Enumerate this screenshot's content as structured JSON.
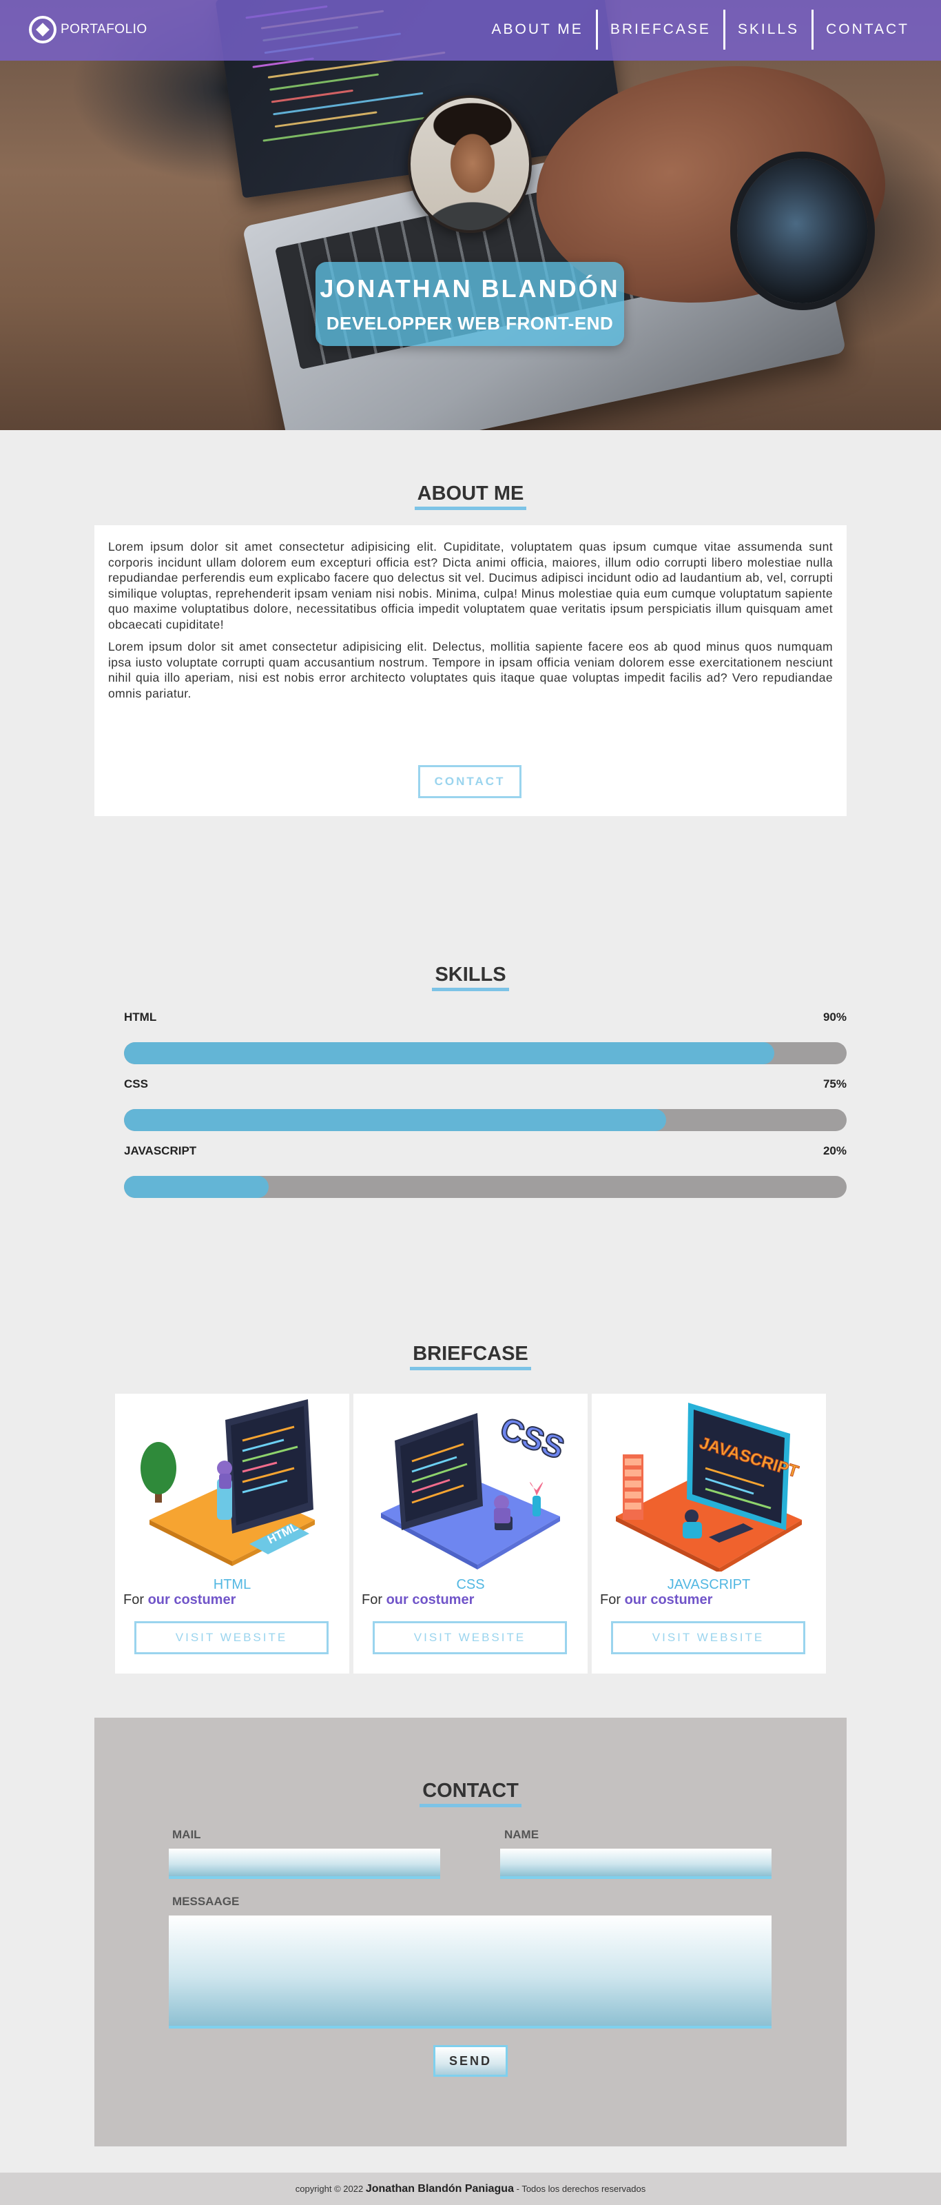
{
  "nav": {
    "logo_text": "PORTAFOLIO",
    "items": [
      {
        "label": "ABOUT ME"
      },
      {
        "label": "BRIEFCASE"
      },
      {
        "label": "SKILLS"
      },
      {
        "label": "CONTACT"
      }
    ]
  },
  "hero": {
    "name": "JONATHAN BLANDÓN",
    "role": "DEVELOPPER WEB FRONT-END"
  },
  "about": {
    "title": "ABOUT ME",
    "paragraph_1": "Lorem ipsum dolor sit amet consectetur adipisicing elit. Cupiditate, voluptatem quas ipsum cumque vitae assumenda sunt corporis incidunt ullam dolorem eum excepturi officia est? Dicta animi officia, maiores, illum odio corrupti libero molestiae nulla repudiandae perferendis eum explicabo facere quo delectus sit vel. Ducimus adipisci incidunt odio ad laudantium ab, vel, corrupti similique voluptas, reprehenderit ipsam veniam nisi nobis. Minima, culpa! Minus molestiae quia eum cumque voluptatum sapiente quo maxime voluptatibus dolore, necessitatibus officia impedit voluptatem quae veritatis ipsum perspiciatis illum quisquam amet obcaecati cupiditate!",
    "paragraph_2": "Lorem ipsum dolor sit amet consectetur adipisicing elit. Delectus, mollitia sapiente facere eos ab quod minus quos numquam ipsa iusto voluptate corrupti quam accusantium nostrum. Tempore in ipsam officia veniam dolorem esse exercitationem nesciunt nihil quia illo aperiam, nisi est nobis error architecto voluptates quis itaque quae voluptas impedit facilis ad? Vero repudiandae omnis pariatur.",
    "contact_button": "CONTACT"
  },
  "skills": {
    "title": "SKILLS",
    "items": [
      {
        "name": "HTML",
        "percent_label": "90%",
        "level": 0.9
      },
      {
        "name": "CSS",
        "percent_label": "75%",
        "level": 0.75
      },
      {
        "name": "JAVASCRIPT",
        "percent_label": "20%",
        "level": 0.2
      }
    ]
  },
  "briefcase": {
    "title": "BRIEFCASE",
    "projects": [
      {
        "title": "HTML",
        "sub_prefix": "For",
        "sub_bold": "our costumer",
        "button": "VISIT WEBSITE",
        "badge": "HTML",
        "accent": "#f6a431"
      },
      {
        "title": "CSS",
        "sub_prefix": "For",
        "sub_bold": "our costumer",
        "button": "VISIT WEBSITE",
        "badge": "CSS",
        "accent": "#6e86f0"
      },
      {
        "title": "JAVASCRIPT",
        "sub_prefix": "For",
        "sub_bold": "our costumer",
        "button": "VISIT WEBSITE",
        "badge": "JAVASCRIPT",
        "accent": "#f0622d"
      }
    ]
  },
  "contact": {
    "title": "CONTACT",
    "mail_label": "MAIL",
    "name_label": "NAME",
    "message_label": "MESSAAGE",
    "send_button": "SEND"
  },
  "footer": {
    "prefix": "copyright © 2022",
    "author": "Jonathan Blandón Paniagua",
    "suffix": "- Todos los derechos reservados"
  },
  "colors": {
    "nav_bg": "#7862cd",
    "accent_blue": "#63b5d6",
    "link_purple": "#7155c9",
    "track_gray": "#a09e9e"
  }
}
